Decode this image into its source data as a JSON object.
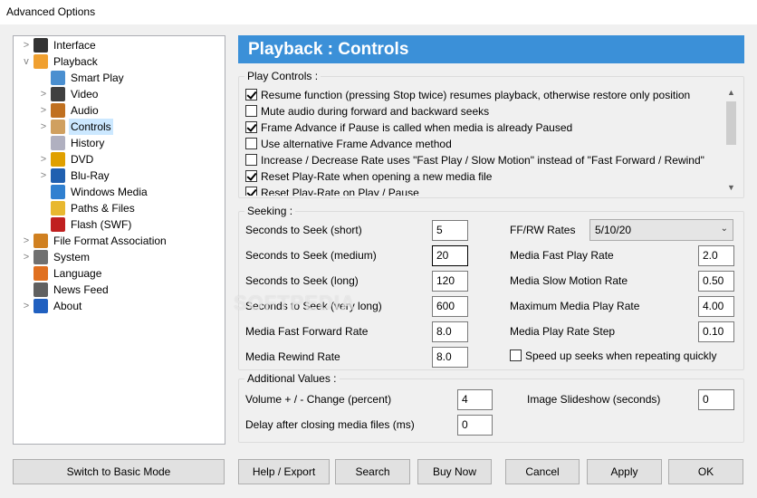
{
  "window": {
    "title": "Advanced Options"
  },
  "tree": [
    {
      "label": "Interface",
      "icon": "interface-icon",
      "color": "#333333",
      "level": 0,
      "exp": ">"
    },
    {
      "label": "Playback",
      "icon": "playback-icon",
      "color": "#f0a030",
      "level": 0,
      "exp": "v"
    },
    {
      "label": "Smart Play",
      "icon": "smart-play-icon",
      "color": "#4a8fd0",
      "level": 1,
      "exp": ""
    },
    {
      "label": "Video",
      "icon": "video-icon",
      "color": "#404040",
      "level": 1,
      "exp": ">"
    },
    {
      "label": "Audio",
      "icon": "audio-icon",
      "color": "#c07020",
      "level": 1,
      "exp": ">"
    },
    {
      "label": "Controls",
      "icon": "controls-icon",
      "color": "#d0a060",
      "level": 1,
      "exp": ">",
      "selected": true
    },
    {
      "label": "History",
      "icon": "history-icon",
      "color": "#b0b0c0",
      "level": 1,
      "exp": ""
    },
    {
      "label": "DVD",
      "icon": "dvd-icon",
      "color": "#e0a000",
      "level": 1,
      "exp": ">"
    },
    {
      "label": "Blu-Ray",
      "icon": "blu-ray-icon",
      "color": "#2060b0",
      "level": 1,
      "exp": ">"
    },
    {
      "label": "Windows Media",
      "icon": "windows-media-icon",
      "color": "#3080d0",
      "level": 1,
      "exp": ""
    },
    {
      "label": "Paths & Files",
      "icon": "folder-icon",
      "color": "#e8b830",
      "level": 1,
      "exp": ""
    },
    {
      "label": "Flash (SWF)",
      "icon": "flash-icon",
      "color": "#c02020",
      "level": 1,
      "exp": ""
    },
    {
      "label": "File Format Association",
      "icon": "file-format-icon",
      "color": "#d08020",
      "level": 0,
      "exp": ">"
    },
    {
      "label": "System",
      "icon": "system-gear-icon",
      "color": "#707070",
      "level": 0,
      "exp": ">"
    },
    {
      "label": "Language",
      "icon": "language-icon",
      "color": "#e07020",
      "level": 0,
      "exp": ""
    },
    {
      "label": "News Feed",
      "icon": "news-feed-icon",
      "color": "#606060",
      "level": 0,
      "exp": ""
    },
    {
      "label": "About",
      "icon": "about-icon",
      "color": "#2060c0",
      "level": 0,
      "exp": ">"
    }
  ],
  "header": {
    "title": "Playback : Controls",
    "bg": "#3b90d8"
  },
  "play_controls": {
    "legend": "Play Controls :",
    "items": [
      {
        "label": "Resume function (pressing Stop twice) resumes playback, otherwise restore only position",
        "checked": true
      },
      {
        "label": "Mute audio during forward and backward seeks",
        "checked": false
      },
      {
        "label": "Frame Advance if Pause is called when media is already Paused",
        "checked": true
      },
      {
        "label": "Use alternative Frame Advance method",
        "checked": false
      },
      {
        "label": "Increase / Decrease Rate uses \"Fast Play / Slow Motion\" instead of \"Fast Forward / Rewind\"",
        "checked": false
      },
      {
        "label": "Reset Play-Rate when opening a new media file",
        "checked": true
      },
      {
        "label": "Reset Play-Rate on Play / Pause",
        "checked": true
      }
    ]
  },
  "seeking": {
    "legend": "Seeking :",
    "left": [
      {
        "label": "Seconds to Seek (short)",
        "value": "5"
      },
      {
        "label": "Seconds to Seek (medium)",
        "value": "20"
      },
      {
        "label": "Seconds to Seek (long)",
        "value": "120"
      },
      {
        "label": "Seconds to Seek (very long)",
        "value": "600"
      },
      {
        "label": "Media Fast Forward Rate",
        "value": "8.0"
      },
      {
        "label": "Media Rewind Rate",
        "value": "8.0"
      }
    ],
    "ffrw": {
      "label": "FF/RW Rates",
      "value": "5/10/20"
    },
    "right": [
      {
        "label": "Media Fast Play Rate",
        "value": "2.0"
      },
      {
        "label": "Media Slow Motion Rate",
        "value": "0.50"
      },
      {
        "label": "Maximum Media Play Rate",
        "value": "4.00"
      },
      {
        "label": "Media Play Rate Step",
        "value": "0.10"
      }
    ],
    "speedup": {
      "label": "Speed up seeks when repeating quickly",
      "checked": false
    }
  },
  "additional": {
    "legend": "Additional Values :",
    "volume": {
      "label": "Volume + / - Change (percent)",
      "value": "4"
    },
    "slideshow": {
      "label": "Image Slideshow (seconds)",
      "value": "0"
    },
    "delay": {
      "label": "Delay after closing media files (ms)",
      "value": "0"
    }
  },
  "buttons": {
    "basic_mode": "Switch to Basic Mode",
    "help_export": "Help / Export",
    "search": "Search",
    "buy_now": "Buy Now",
    "cancel": "Cancel",
    "apply": "Apply",
    "ok": "OK"
  },
  "watermark": "SOFTPEDIA"
}
